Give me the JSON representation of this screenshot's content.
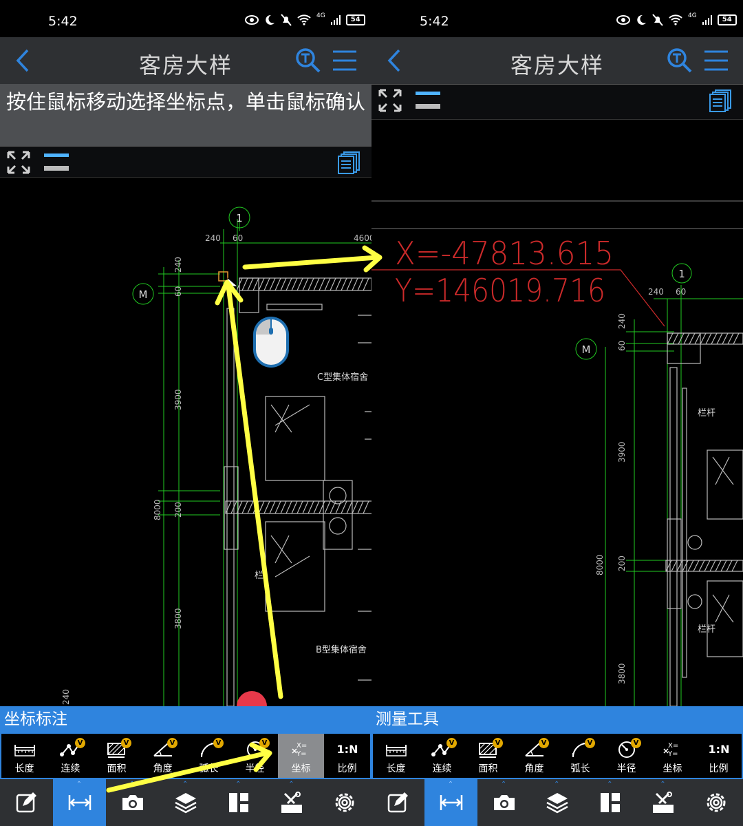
{
  "status": {
    "time": "5:42",
    "network": "4G",
    "battery": "54"
  },
  "left": {
    "title": "客房大样",
    "instruction": "按住鼠标移动选择坐标点，单击鼠标确认",
    "section_title": "坐标标注",
    "cad": {
      "dims_top": [
        "240",
        "60",
        "4600"
      ],
      "dims_left": [
        "240",
        "60",
        "3900",
        "8000",
        "200",
        "3800",
        "240"
      ],
      "axis_labels": [
        "1",
        "M"
      ],
      "room_labels": [
        "C型集体宿舍",
        "B型集体宿舍",
        "栏"
      ]
    }
  },
  "right": {
    "title": "客房大样",
    "section_title": "测量工具",
    "coord_x": "X=-47813.615",
    "coord_y": "Y=146019.716",
    "cad": {
      "dims_top": [
        "240",
        "60"
      ],
      "dims_left": [
        "240",
        "60",
        "3900",
        "8000",
        "200",
        "3800"
      ],
      "axis_labels": [
        "1",
        "M"
      ],
      "room_labels": [
        "栏杆",
        "栏杆"
      ]
    }
  },
  "tools": [
    {
      "label": "长度",
      "icon": "ruler-icon",
      "badge": false
    },
    {
      "label": "连续",
      "icon": "polyline-icon",
      "badge": true
    },
    {
      "label": "面积",
      "icon": "area-icon",
      "badge": true
    },
    {
      "label": "角度",
      "icon": "angle-icon",
      "badge": true
    },
    {
      "label": "弧长",
      "icon": "arc-icon",
      "badge": true
    },
    {
      "label": "半径",
      "icon": "radius-icon",
      "badge": true
    },
    {
      "label": "坐标",
      "icon": "coordinate-icon",
      "badge": false
    },
    {
      "label": "比例",
      "icon": "scale-icon",
      "badge": false
    }
  ],
  "tool_badge": "V",
  "scale_icon_text": "1:N",
  "coord_icon_text": [
    "X=",
    "Y="
  ],
  "selected_tool_left": "坐标",
  "bottom_nav": [
    "edit-icon",
    "measure-icon",
    "camera-icon",
    "layers-icon",
    "layout-icon",
    "tools-icon",
    "settings-icon"
  ],
  "colors": {
    "accent": "#2f84de",
    "annotation": "#ffff44",
    "cad_green": "#22cc22",
    "cad_red": "#cc2a2a",
    "badge": "#e2a800"
  }
}
